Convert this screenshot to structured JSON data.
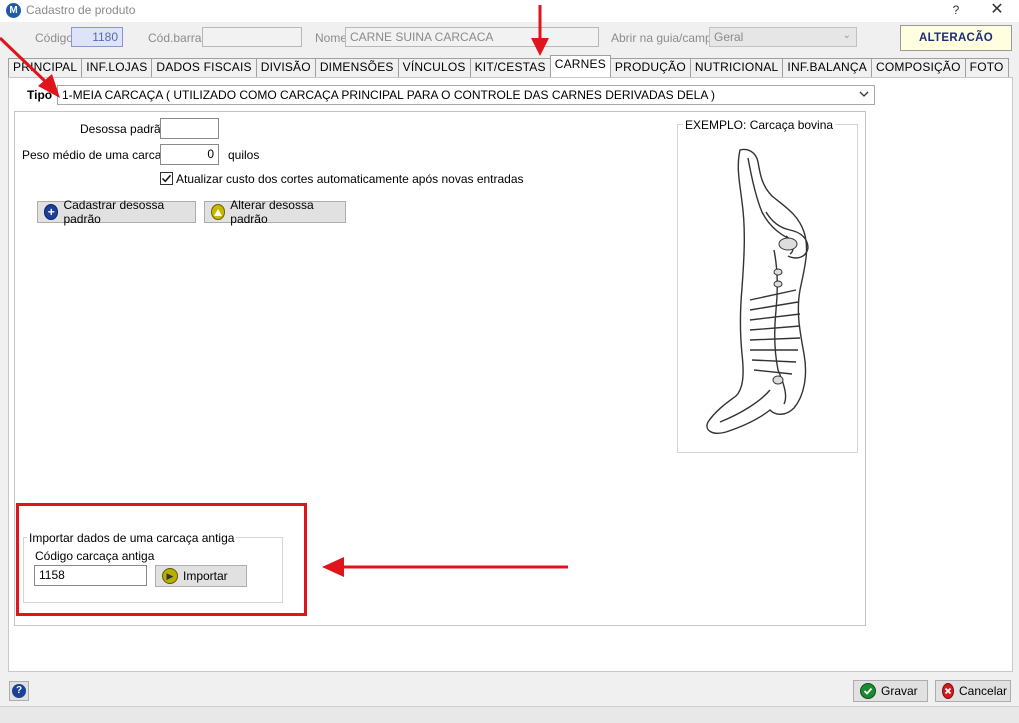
{
  "window": {
    "title": "Cadastro de produto",
    "icon_letter": "M",
    "help_label": "?",
    "close_label": "✕"
  },
  "header": {
    "codigo_label": "Código",
    "codigo_value": "1180",
    "cod_barras_label": "Cód.barras",
    "cod_barras_value": "",
    "nome_label": "Nome",
    "nome_value": "CARNE SUINA CARCACA",
    "abrir_label": "Abrir na guia/campo",
    "abrir_value": "Geral",
    "status": "ALTERACÃO"
  },
  "tabs": [
    {
      "label": "PRINCIPAL"
    },
    {
      "label": "INF.LOJAS"
    },
    {
      "label": "DADOS FISCAIS"
    },
    {
      "label": "DIVISÃO"
    },
    {
      "label": "DIMENSÕES"
    },
    {
      "label": "VÍNCULOS"
    },
    {
      "label": "KIT/CESTAS"
    },
    {
      "label": "CARNES",
      "active": true
    },
    {
      "label": "PRODUÇÃO"
    },
    {
      "label": "NUTRICIONAL"
    },
    {
      "label": "INF.BALANÇA"
    },
    {
      "label": "COMPOSIÇÃO"
    },
    {
      "label": "FOTO"
    }
  ],
  "carnes": {
    "tipo_label": "Tipo",
    "tipo_value": "1-MEIA CARCAÇA ( UTILIZADO COMO CARCAÇA PRINCIPAL PARA O CONTROLE DAS CARNES DERIVADAS DELA )",
    "desossa_label": "Desossa padrão",
    "desossa_value": "",
    "peso_label": "Peso médio de uma carcaça",
    "peso_value": "0",
    "peso_unit": "quilos",
    "atualizar_label": "Atualizar custo dos cortes automaticamente após novas entradas",
    "atualizar_checked": true,
    "cadastrar_btn": "Cadastrar desossa padrão",
    "alterar_btn": "Alterar desossa padrão",
    "exemplo_title": "EXEMPLO: Carcaça bovina",
    "importar_group": "Importar dados de uma carcaça antiga",
    "codigo_antiga_label": "Código carcaça antiga",
    "codigo_antiga_value": "1158",
    "importar_btn": "Importar"
  },
  "footer": {
    "gravar_btn": "Gravar",
    "cancelar_btn": "Cancelar"
  },
  "colors": {
    "annotation_red": "#e0141b",
    "plus_blue": "#1c3f9c",
    "alter_yellow": "#c9b800",
    "ok_green": "#1d8a2f",
    "cancel_red": "#d21c1c"
  }
}
